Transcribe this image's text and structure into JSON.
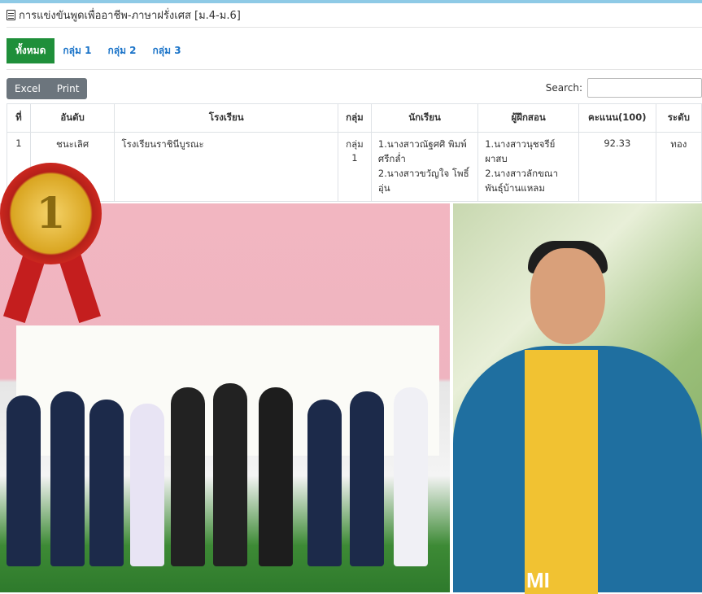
{
  "page": {
    "title": "การแข่งขันพูดเพื่ออาชีพ-ภาษาฝรั่งเศส [ม.4-ม.6]"
  },
  "tabs": [
    "ทั้งหมด",
    "กลุ่ม 1",
    "กลุ่ม 2",
    "กลุ่ม 3"
  ],
  "toolbar": {
    "excel_label": "Excel",
    "print_label": "Print"
  },
  "search": {
    "label": "Search:",
    "value": ""
  },
  "table": {
    "headers": [
      "ที่",
      "อันดับ",
      "โรงเรียน",
      "กลุ่ม",
      "นักเรียน",
      "ผู้ฝึกสอน",
      "คะแนน(100)",
      "ระดับ"
    ],
    "rows": [
      {
        "no": "1",
        "rank": "ชนะเลิศ",
        "school": "โรงเรียนราชินีบูรณะ",
        "group": "กลุ่ม 1",
        "student1": "1.นางสาวณัฐศศิ พิมพ์ศรีกล่ำ",
        "student2": "2.นางสาวขวัญใจ โพธิ์อุ่น",
        "coach1": "1.นางสาวนุชจรีย์ ผาสบ",
        "coach2": "2.นางสาวลักขณา พันธุ์บ้านแหลม",
        "score": "92.33",
        "level": "ทอง"
      }
    ]
  },
  "photo": {
    "medal_number": "1",
    "portrait_shirt_text": "MI"
  }
}
